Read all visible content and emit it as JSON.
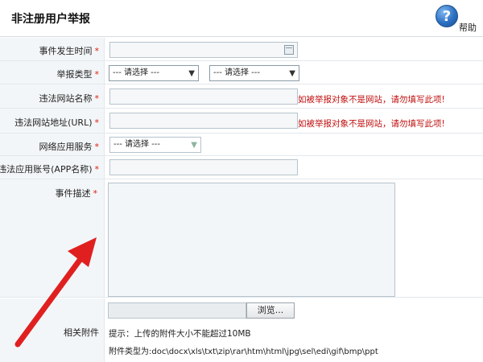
{
  "header": {
    "title": "非注册用户举报",
    "help_label": "帮助",
    "help_glyph": "?"
  },
  "fields": {
    "event_time": {
      "label": "事件发生时间",
      "required_mark": "*"
    },
    "report_type": {
      "label": "举报类型",
      "required_mark": "*",
      "select1": "--- 请选择 ---",
      "select2": "--- 请选择 ---"
    },
    "site_name": {
      "label": "违法网站名称",
      "required_mark": "*",
      "hint": "如被举报对象不是网站，请勿填写此项!"
    },
    "site_url": {
      "label": "违法网站地址(URL)",
      "required_mark": "*",
      "hint": "如被举报对象不是网站，请勿填写此项!"
    },
    "net_service": {
      "label": "网络应用服务",
      "required_mark": "*",
      "select": "--- 请选择 ---"
    },
    "app_account": {
      "label": "违法应用账号(APP名称)",
      "required_mark": "*"
    },
    "description": {
      "label": "事件描述",
      "required_mark": "*"
    },
    "attachment": {
      "label": "相关附件",
      "browse_label": "浏览...",
      "size_note": "提示：上传的附件大小不能超过10MB",
      "type_note": "附件类型为:doc\\docx\\xls\\txt\\zip\\rar\\htm\\html\\jpg\\sel\\edi\\gif\\bmp\\ppt"
    }
  },
  "colors": {
    "required": "#dd1111",
    "hint": "#c0100f",
    "arrow": "#e02020"
  }
}
